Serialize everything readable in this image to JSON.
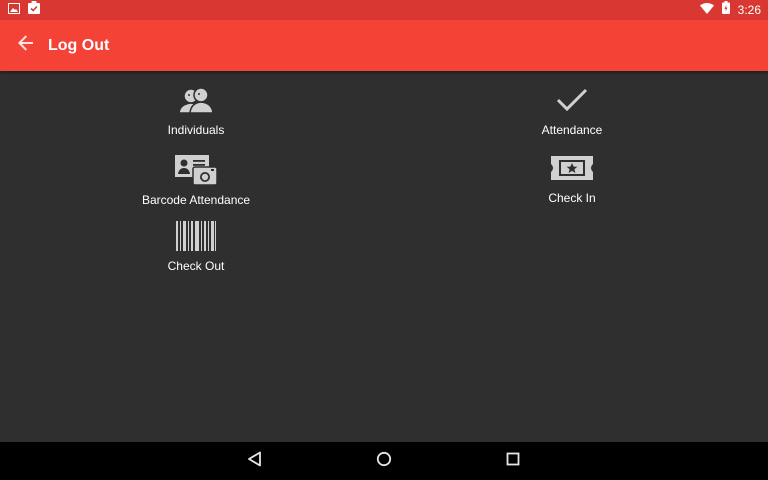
{
  "status_bar": {
    "time": "3:26",
    "icons": [
      "image-notification-icon",
      "clipboard-notification-icon",
      "wifi-icon",
      "battery-icon"
    ],
    "color": "#d93832"
  },
  "app_bar": {
    "title": "Log Out",
    "back_icon": "arrow-back-icon",
    "color": "#f44336"
  },
  "menu": {
    "individuals": {
      "label": "Individuals",
      "icon": "people-icon"
    },
    "attendance": {
      "label": "Attendance",
      "icon": "checkmark-icon"
    },
    "barcode_attendance": {
      "label": "Barcode Attendance",
      "icon": "id-card-camera-icon"
    },
    "check_in": {
      "label": "Check In",
      "icon": "ticket-icon"
    },
    "check_out": {
      "label": "Check Out",
      "icon": "barcode-icon"
    }
  },
  "nav_bar": {
    "buttons": [
      "back-triangle-icon",
      "home-circle-icon",
      "recents-square-icon"
    ]
  },
  "colors": {
    "background": "#2f2f2f",
    "icon": "#d0d0d0"
  }
}
